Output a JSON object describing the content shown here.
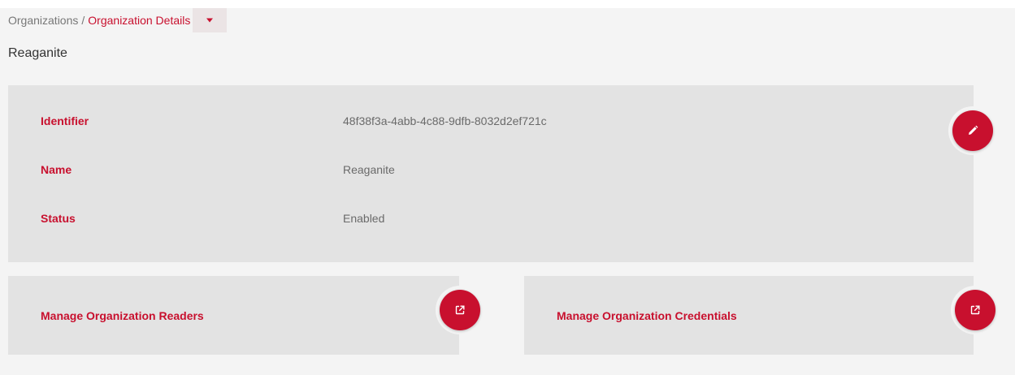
{
  "breadcrumb": {
    "parent": "Organizations",
    "separator": "/",
    "current": "Organization Details"
  },
  "page_title": "Reaganite",
  "details": {
    "identifier_label": "Identifier",
    "identifier_value": "48f38f3a-4abb-4c88-9dfb-8032d2ef721c",
    "name_label": "Name",
    "name_value": "Reaganite",
    "status_label": "Status",
    "status_value": "Enabled"
  },
  "actions": {
    "manage_readers_label": "Manage Organization Readers",
    "manage_credentials_label": "Manage Organization Credentials"
  },
  "icons": {
    "edit": "pencil-icon",
    "open_link": "external-link-icon",
    "dropdown": "caret-down-icon"
  },
  "colors": {
    "accent": "#c8102e",
    "card_background": "#e3e3e3",
    "page_background": "#f4f4f4"
  }
}
